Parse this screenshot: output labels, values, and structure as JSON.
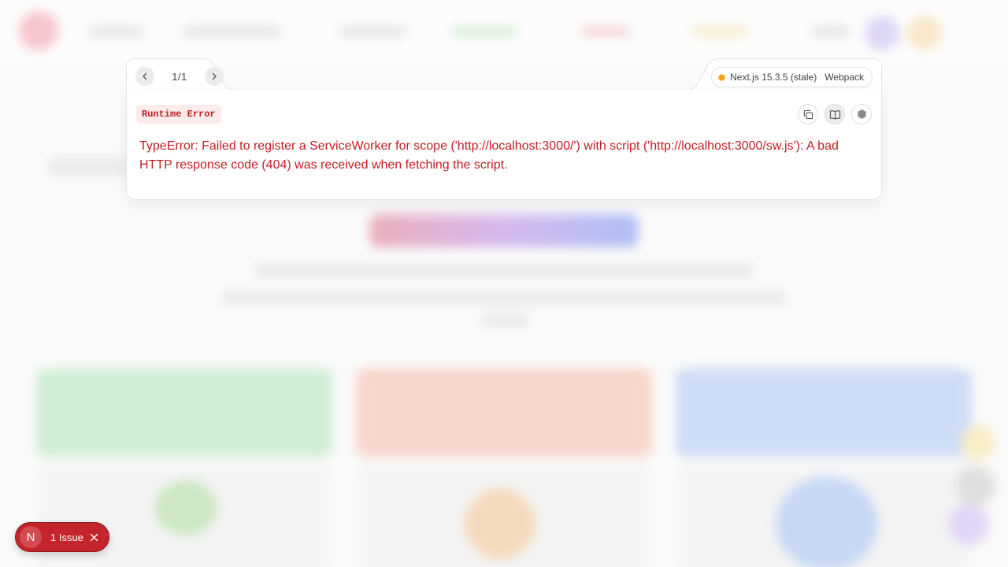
{
  "overlay": {
    "pager": {
      "current_total": "1/1",
      "prev_icon": "chevron-left-icon",
      "next_icon": "chevron-right-icon"
    },
    "version": {
      "status_color": "#f5a20b",
      "label": "Next.js 15.3.5 (stale)",
      "bundler": "Webpack"
    },
    "error": {
      "type_label": "Runtime Error",
      "message": "TypeError: Failed to register a ServiceWorker for scope ('http://localhost:3000/') with script ('http://localhost:3000/sw.js'): A bad HTTP response code (404) was received when fetching the script.",
      "color": "#c21e24"
    },
    "toolbar": {
      "buttons": [
        "copy-icon",
        "book-icon",
        "nodejs-icon"
      ]
    }
  },
  "issues_toast": {
    "logo_letter": "N",
    "label": "1 Issue",
    "close_icon": "close-icon",
    "color": "#c4242c"
  }
}
